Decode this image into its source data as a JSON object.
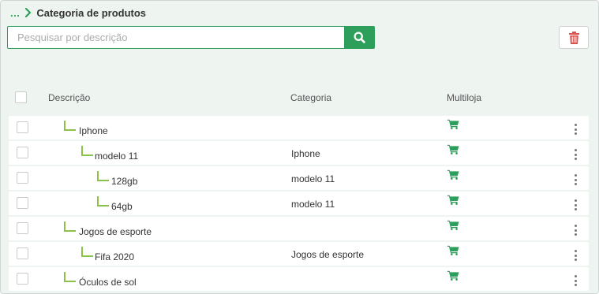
{
  "breadcrumb": {
    "ellipsis": "...",
    "title": "Categoria de produtos"
  },
  "search": {
    "placeholder": "Pesquisar por descrição",
    "value": ""
  },
  "table": {
    "headers": {
      "description": "Descrição",
      "category": "Categoria",
      "multiloja": "Multiloja"
    },
    "rows": [
      {
        "name": "Iphone",
        "category": "",
        "level": 1,
        "multiloja": true
      },
      {
        "name": "modelo 11",
        "category": "Iphone",
        "level": 2,
        "multiloja": true
      },
      {
        "name": "128gb",
        "category": "modelo 11",
        "level": 3,
        "multiloja": true
      },
      {
        "name": "64gb",
        "category": "modelo 11",
        "level": 3,
        "multiloja": true
      },
      {
        "name": "Jogos de esporte",
        "category": "",
        "level": 1,
        "multiloja": true
      },
      {
        "name": "Fifa 2020",
        "category": "Jogos de esporte",
        "level": 2,
        "multiloja": true
      },
      {
        "name": "Óculos de sol",
        "category": "",
        "level": 1,
        "multiloja": true
      }
    ]
  },
  "icons": {
    "breadcrumb_chevron": "chevron-right-icon",
    "search": "search-icon",
    "delete": "trash-icon",
    "multiloja": "shopping-cart-icon",
    "row_menu": "kebab-menu-icon"
  },
  "colors": {
    "accent": "#2e9e5b",
    "tree_line": "#8bc34a",
    "delete": "#d9534f",
    "background": "#eef5f1"
  }
}
